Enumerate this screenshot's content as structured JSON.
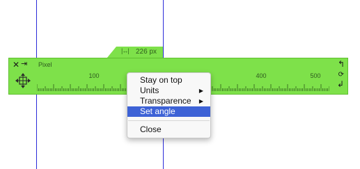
{
  "colors": {
    "ruler_bg": "#7ee14a",
    "guide": "#2b2bd9",
    "menu_highlight": "#3d62d6"
  },
  "ruler": {
    "tab_icon": "|↔|",
    "tab_text": "226 px",
    "unit_label": "Pixel",
    "tick_labels": [
      "100",
      "400",
      "500"
    ]
  },
  "icons": {
    "close": "close-icon",
    "pin": "pin-icon",
    "move": "move-icon",
    "undo": "undo-icon",
    "rotate": "rotate-icon",
    "redo": "redo-icon"
  },
  "context_menu": {
    "items": [
      {
        "label": "Stay on top",
        "submenu": false
      },
      {
        "label": "Units",
        "submenu": true
      },
      {
        "label": "Transparence",
        "submenu": true
      },
      {
        "label": "Set angle",
        "submenu": false,
        "highlighted": true
      },
      {
        "label": "Close",
        "submenu": false
      }
    ]
  }
}
